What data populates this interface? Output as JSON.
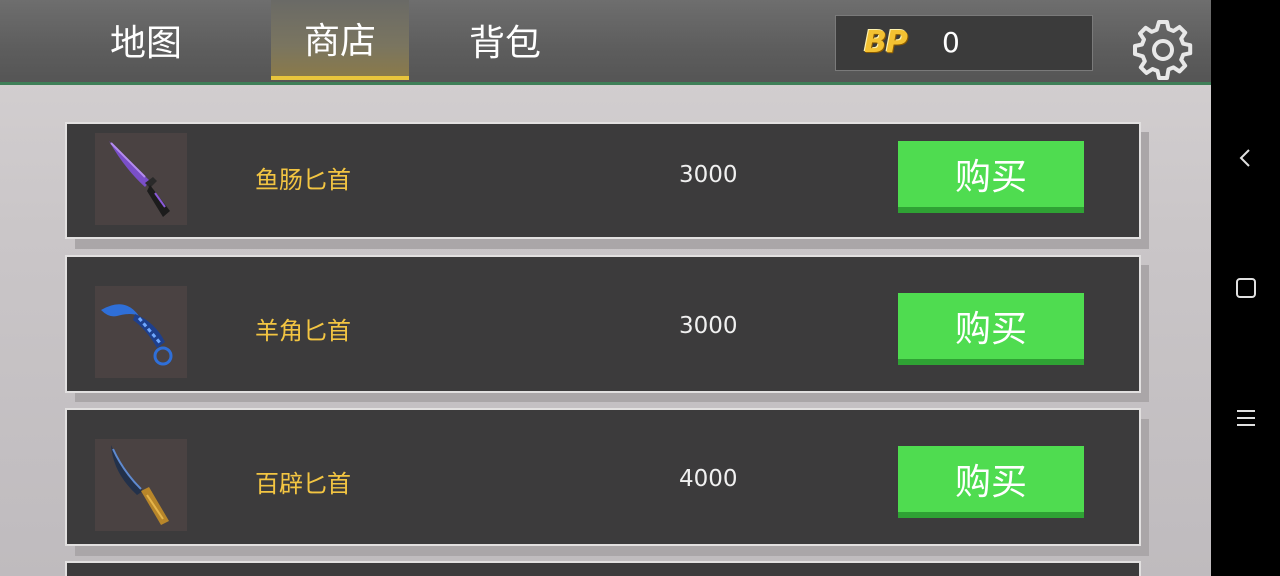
{
  "tabs": [
    {
      "label": "地图",
      "active": false
    },
    {
      "label": "商店",
      "active": true
    },
    {
      "label": "背包",
      "active": false
    }
  ],
  "currency": {
    "logo": "BP",
    "value": "0"
  },
  "settings_icon": "gear-icon",
  "accent_colors": {
    "tab_underline": "#e9c53c",
    "item_name": "#f3c542",
    "buy_button": "#4fdc50"
  },
  "shop_items": [
    {
      "name": "鱼肠匕首",
      "price": "3000",
      "buy_label": "购买",
      "icon": "knife-purple-icon"
    },
    {
      "name": "羊角匕首",
      "price": "3000",
      "buy_label": "购买",
      "icon": "karambit-blue-icon"
    },
    {
      "name": "百辟匕首",
      "price": "4000",
      "buy_label": "购买",
      "icon": "knife-gold-blue-icon"
    }
  ],
  "system_nav": [
    {
      "icon": "back-icon"
    },
    {
      "icon": "home-icon"
    },
    {
      "icon": "menu-icon"
    }
  ]
}
